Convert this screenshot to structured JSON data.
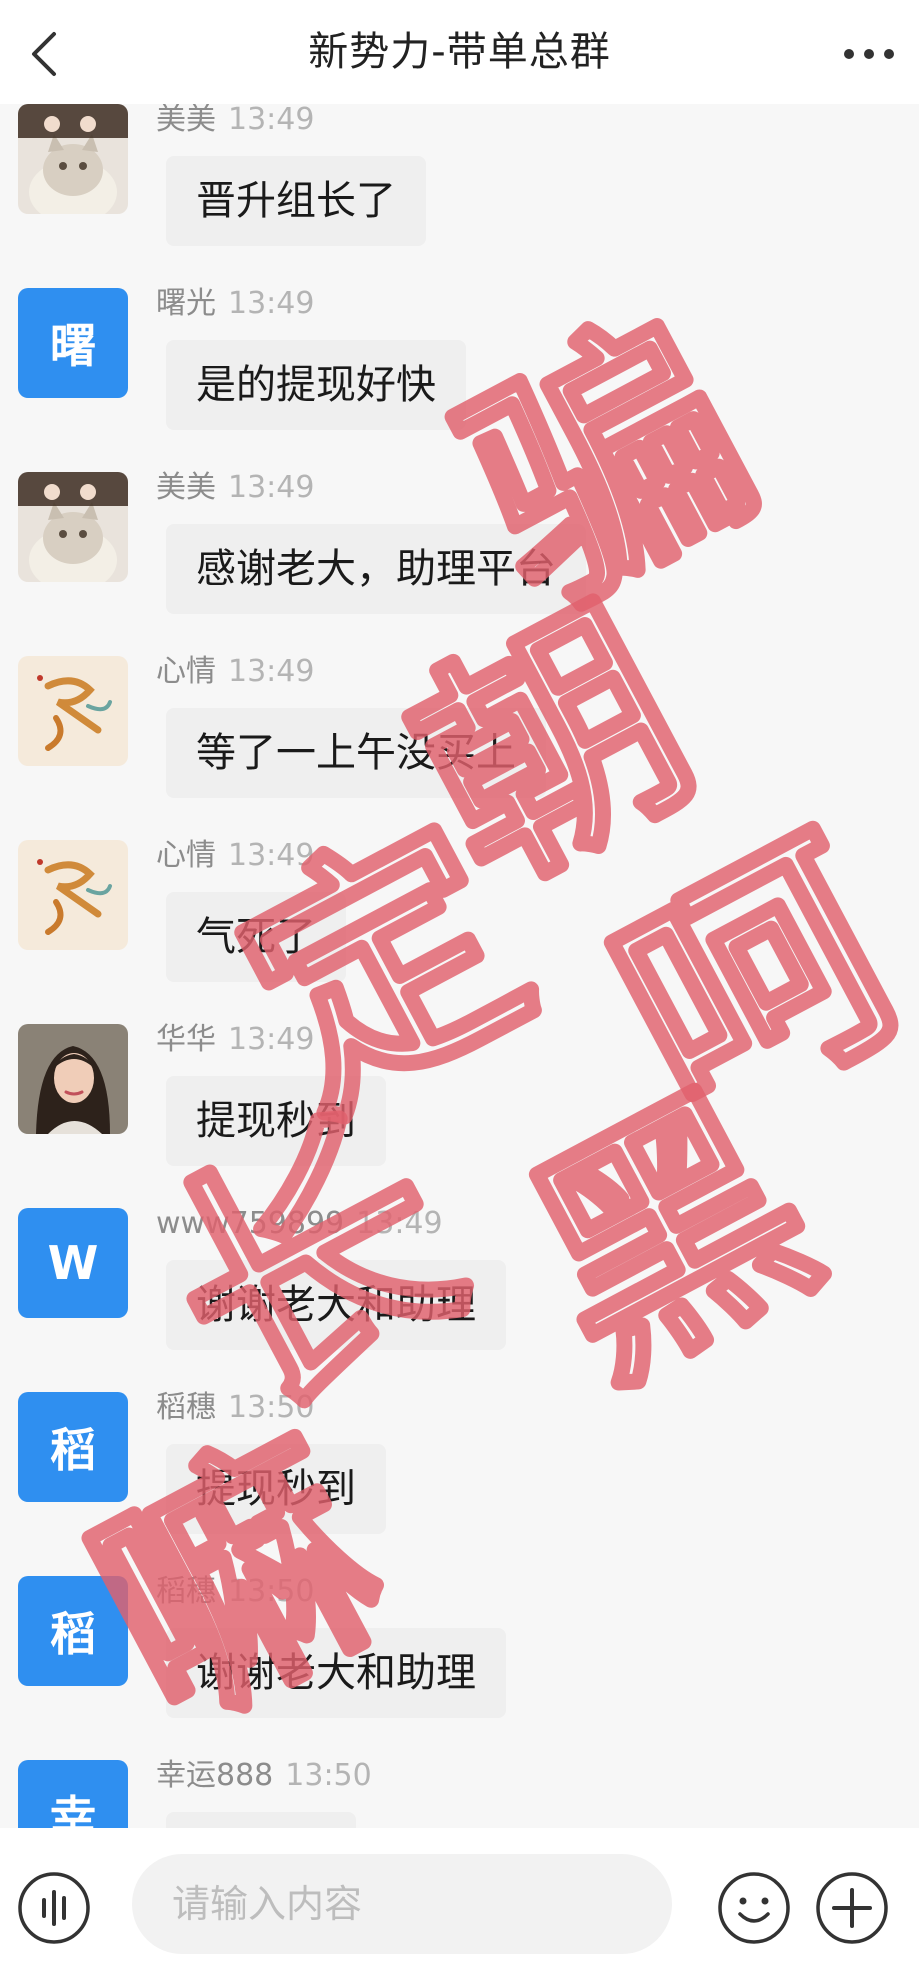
{
  "header": {
    "title": "新势力-带单总群",
    "back_icon": "chevron-left-icon",
    "more_icon": "ellipsis-icon"
  },
  "messages": [
    {
      "sender": "美美",
      "time": "13:49",
      "text": "晋升组长了",
      "avatar": {
        "type": "photo",
        "icon": "cat-photo-avatar"
      }
    },
    {
      "sender": "曙光",
      "time": "13:49",
      "text": "是的提现好快",
      "avatar": {
        "type": "letter",
        "letter": "曙",
        "color": "#2f8ff0"
      }
    },
    {
      "sender": "美美",
      "time": "13:49",
      "text": "感谢老大，助理平台",
      "avatar": {
        "type": "photo",
        "icon": "cat-photo-avatar"
      }
    },
    {
      "sender": "心情",
      "time": "13:49",
      "text": "等了一上午没买上",
      "avatar": {
        "type": "photo",
        "icon": "calligraphy-avatar"
      }
    },
    {
      "sender": "心情",
      "time": "13:49",
      "text": "气死了",
      "avatar": {
        "type": "photo",
        "icon": "calligraphy-avatar"
      }
    },
    {
      "sender": "华华",
      "time": "13:49",
      "text": "提现秒到",
      "avatar": {
        "type": "photo",
        "icon": "woman-photo-avatar"
      }
    },
    {
      "sender": "www759899",
      "time": "13:49",
      "text": "谢谢老大和助理",
      "avatar": {
        "type": "letter",
        "letter": "W",
        "color": "#2f8ff0"
      }
    },
    {
      "sender": "稻穗",
      "time": "13:50",
      "text": "提现秒到",
      "avatar": {
        "type": "letter",
        "letter": "稻",
        "color": "#2f8ff0"
      }
    },
    {
      "sender": "稻穗",
      "time": "13:50",
      "text": "谢谢老大和助理",
      "avatar": {
        "type": "letter",
        "letter": "稻",
        "color": "#2f8ff0"
      }
    },
    {
      "sender": "幸运888",
      "time": "13:50",
      "text": "",
      "avatar": {
        "type": "letter",
        "letter": "幸",
        "color": "#2f8ff0"
      }
    }
  ],
  "watermark": {
    "color": "#e0606c",
    "lines": [
      "骗",
      "朝",
      "定",
      "长",
      "嘛",
      "呵",
      "黑"
    ]
  },
  "footer": {
    "placeholder": "请输入内容",
    "voice_icon": "voice-icon",
    "emoji_icon": "emoji-icon",
    "plus_icon": "plus-icon"
  }
}
